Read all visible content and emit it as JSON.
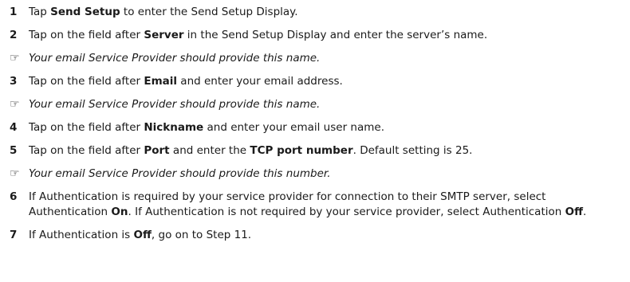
{
  "note_icon": "pointing-hand-icon",
  "note_glyph": "☞",
  "steps": [
    {
      "num": "1",
      "parts": [
        "Tap ",
        "Send Setup",
        " to enter the Send Setup Display."
      ]
    },
    {
      "num": "2",
      "parts": [
        "Tap on the field after ",
        "Server",
        " in the Send Setup Display and enter the server’s name."
      ]
    },
    {
      "num": "3",
      "parts": [
        "Tap on the field after ",
        "Email",
        " and enter your email address."
      ]
    },
    {
      "num": "4",
      "parts": [
        "Tap on the field after ",
        "Nickname",
        " and enter your email user name."
      ]
    },
    {
      "num": "5",
      "parts": [
        "Tap on the field after ",
        "Port",
        " and enter the ",
        "TCP port number",
        ". Default setting is 25."
      ]
    },
    {
      "num": "6",
      "parts": [
        "If Authentication is required by your service provider for connection to their SMTP server, select Authentication ",
        "On",
        ". If Authentication is not required by your service provider, select Authentication ",
        "Off",
        "."
      ]
    },
    {
      "num": "7",
      "parts": [
        "If Authentication is ",
        "Off",
        ", go on to Step 11."
      ]
    }
  ],
  "notes": [
    "Your email Service Provider should provide this name.",
    "Your email Service Provider should provide this name.",
    "Your email Service Provider should provide this number."
  ]
}
